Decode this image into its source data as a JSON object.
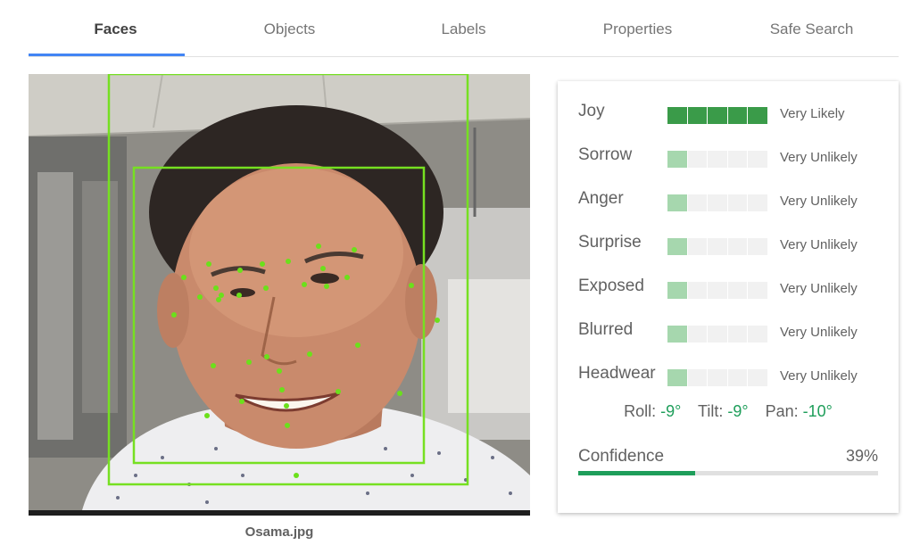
{
  "tabs": [
    {
      "label": "Faces",
      "active": true
    },
    {
      "label": "Objects",
      "active": false
    },
    {
      "label": "Labels",
      "active": false
    },
    {
      "label": "Properties",
      "active": false
    },
    {
      "label": "Safe Search",
      "active": false
    }
  ],
  "image": {
    "filename": "Osama.jpg"
  },
  "attributes": [
    {
      "name": "Joy",
      "likelihood": "Very Likely",
      "level": 5
    },
    {
      "name": "Sorrow",
      "likelihood": "Very Unlikely",
      "level": 1
    },
    {
      "name": "Anger",
      "likelihood": "Very Unlikely",
      "level": 1
    },
    {
      "name": "Surprise",
      "likelihood": "Very Unlikely",
      "level": 1
    },
    {
      "name": "Exposed",
      "likelihood": "Very Unlikely",
      "level": 1
    },
    {
      "name": "Blurred",
      "likelihood": "Very Unlikely",
      "level": 1
    },
    {
      "name": "Headwear",
      "likelihood": "Very Unlikely",
      "level": 1
    }
  ],
  "angles": {
    "roll_label": "Roll:",
    "roll": "-9°",
    "tilt_label": "Tilt:",
    "tilt": "-9°",
    "pan_label": "Pan:",
    "pan": "-10°"
  },
  "confidence": {
    "label": "Confidence",
    "value_text": "39%",
    "fraction": 0.39
  },
  "colors": {
    "tab_indicator": "#4285f4",
    "meter_strong": "#3a9b49",
    "meter_weak": "#a6d7ae",
    "angle_value": "#1e9e5a",
    "confidence_bar": "#1e9e5a",
    "face_box": "#76e021",
    "landmark": "#6be01b"
  }
}
